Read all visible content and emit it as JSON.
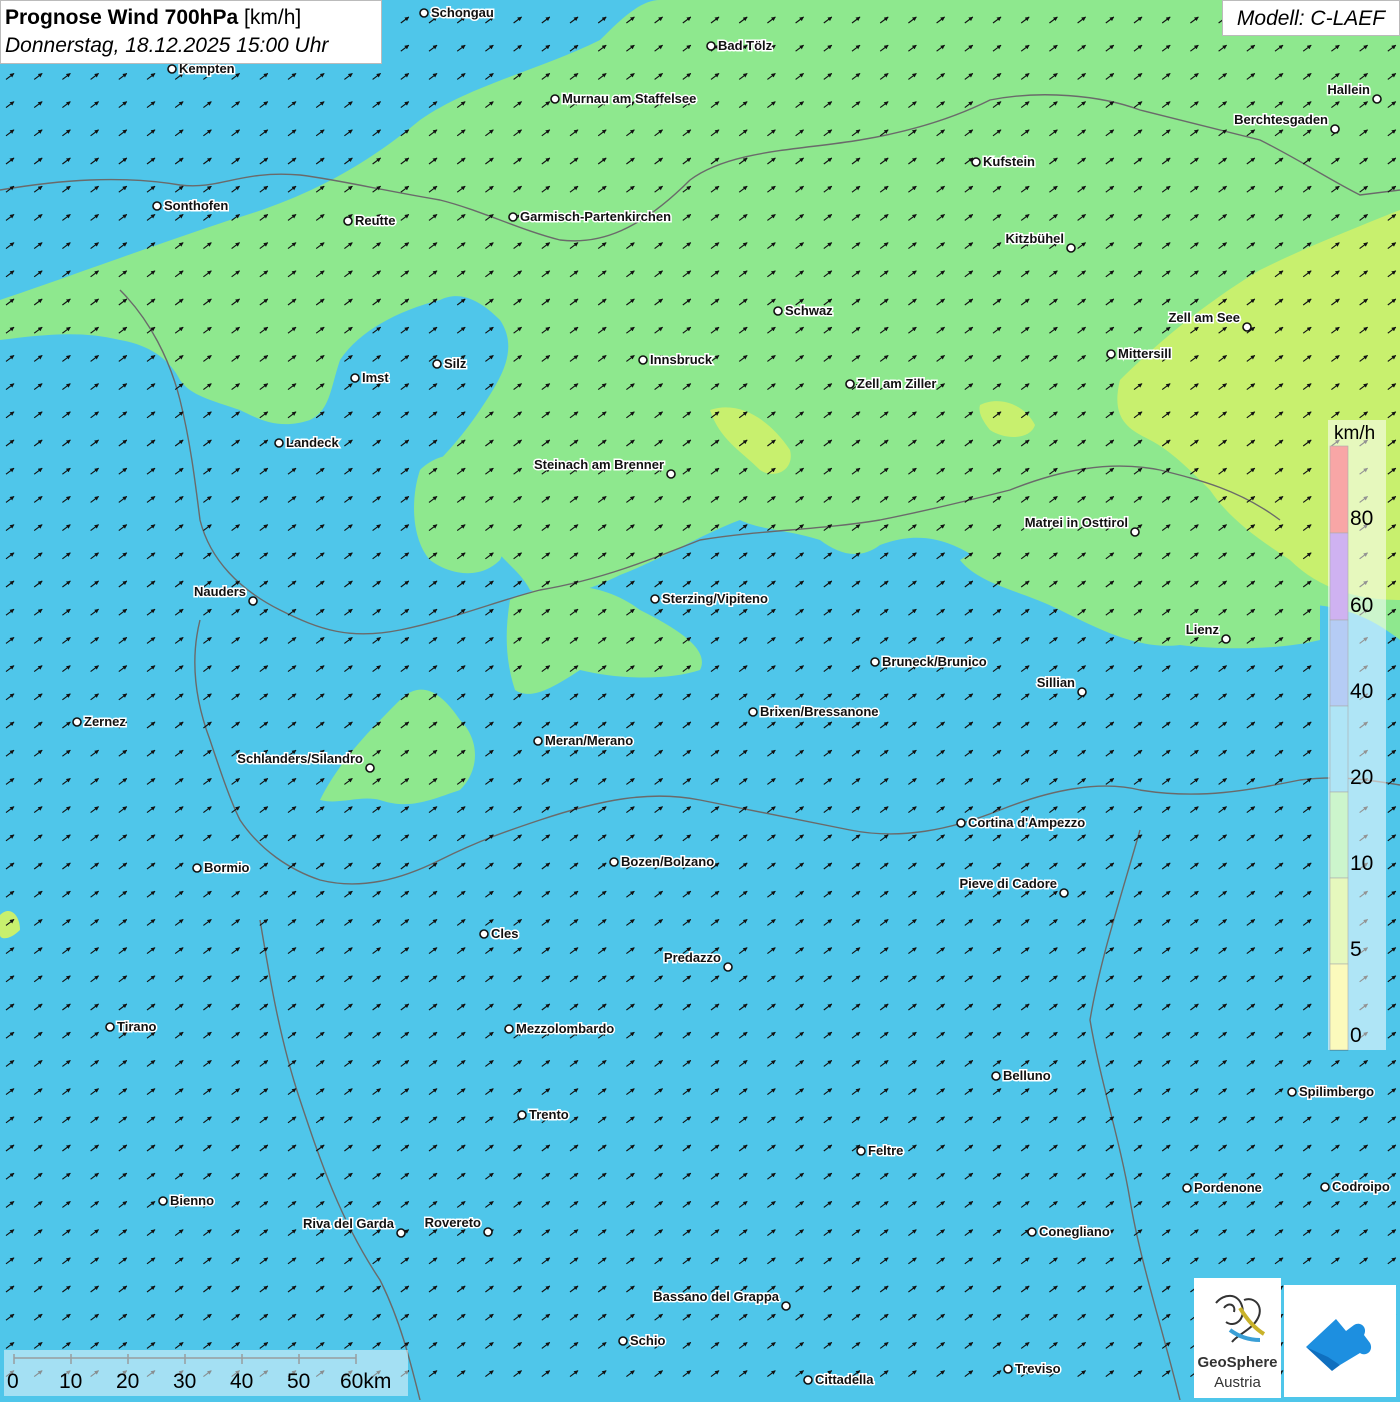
{
  "header": {
    "title_bold": "Prognose Wind 700hPa",
    "title_unit": "[km/h]",
    "datetime": "Donnerstag, 18.12.2025 15:00 Uhr",
    "model": "Modell: C-LAEF"
  },
  "colors": {
    "wind_0_5": "#f5f36a",
    "wind_5_10": "#c8f06e",
    "wind_10_20": "#8ee88e",
    "wind_20_40": "#4fc6ea",
    "wind_40_60": "#5b8ee8",
    "wind_60_80": "#9456e0",
    "wind_80_plus": "#f03a3a",
    "arrow": "#111111",
    "border_lines": "#6a6a6a"
  },
  "legend": {
    "unit": "km/h",
    "labels": [
      "80",
      "60",
      "40",
      "20",
      "10",
      "5",
      "0"
    ]
  },
  "scale": {
    "ticks": [
      "0",
      "10",
      "20",
      "30",
      "40",
      "50",
      "60km"
    ]
  },
  "cities": [
    {
      "name": "Schongau",
      "label_side": "right"
    },
    {
      "name": "Kempten",
      "label_side": "right"
    },
    {
      "name": "Bad Tölz",
      "label_side": "right"
    },
    {
      "name": "Murnau am Staffelsee",
      "label_side": "right"
    },
    {
      "name": "Hallein",
      "label_side": "left"
    },
    {
      "name": "Berchtesgaden",
      "label_side": "left"
    },
    {
      "name": "Kufstein",
      "label_side": "right"
    },
    {
      "name": "Sonthofen",
      "label_side": "right"
    },
    {
      "name": "Reutte",
      "label_side": "right"
    },
    {
      "name": "Garmisch-Partenkirchen",
      "label_side": "right"
    },
    {
      "name": "Kitzbühel",
      "label_side": "left"
    },
    {
      "name": "Schwaz",
      "label_side": "right"
    },
    {
      "name": "Zell am See",
      "label_side": "left"
    },
    {
      "name": "Mittersill",
      "label_side": "right"
    },
    {
      "name": "Innsbruck",
      "label_side": "right"
    },
    {
      "name": "Zell am Ziller",
      "label_side": "right"
    },
    {
      "name": "Silz",
      "label_side": "right"
    },
    {
      "name": "Imst",
      "label_side": "right"
    },
    {
      "name": "Landeck",
      "label_side": "right"
    },
    {
      "name": "Steinach am Brenner",
      "label_side": "left"
    },
    {
      "name": "Matrei in Osttirol",
      "label_side": "left"
    },
    {
      "name": "Nauders",
      "label_side": "left"
    },
    {
      "name": "Sterzing/Vipiteno",
      "label_side": "right"
    },
    {
      "name": "Lienz",
      "label_side": "left"
    },
    {
      "name": "Bruneck/Brunico",
      "label_side": "right"
    },
    {
      "name": "Sillian",
      "label_side": "left"
    },
    {
      "name": "Zernez",
      "label_side": "right"
    },
    {
      "name": "Brixen/Bressanone",
      "label_side": "right"
    },
    {
      "name": "Meran/Merano",
      "label_side": "right"
    },
    {
      "name": "Schlanders/Silandro",
      "label_side": "left"
    },
    {
      "name": "Cortina d'Ampezzo",
      "label_side": "right"
    },
    {
      "name": "Bozen/Bolzano",
      "label_side": "right"
    },
    {
      "name": "Bormio",
      "label_side": "right"
    },
    {
      "name": "Pieve di Cadore",
      "label_side": "left"
    },
    {
      "name": "Cles",
      "label_side": "right"
    },
    {
      "name": "Predazzo",
      "label_side": "left"
    },
    {
      "name": "Tirano",
      "label_side": "right"
    },
    {
      "name": "Mezzolombardo",
      "label_side": "right"
    },
    {
      "name": "Belluno",
      "label_side": "right"
    },
    {
      "name": "Spilimbergo",
      "label_side": "right"
    },
    {
      "name": "Trento",
      "label_side": "right"
    },
    {
      "name": "Feltre",
      "label_side": "right"
    },
    {
      "name": "Pordenone",
      "label_side": "right"
    },
    {
      "name": "Codroipo",
      "label_side": "right"
    },
    {
      "name": "Bienno",
      "label_side": "right"
    },
    {
      "name": "Riva del Garda",
      "label_side": "left"
    },
    {
      "name": "Rovereto",
      "label_side": "left"
    },
    {
      "name": "Conegliano",
      "label_side": "right"
    },
    {
      "name": "Bassano del Grappa",
      "label_side": "left"
    },
    {
      "name": "Schio",
      "label_side": "right"
    },
    {
      "name": "Treviso",
      "label_side": "right"
    },
    {
      "name": "Cittadella",
      "label_side": "right"
    }
  ],
  "logos": {
    "geosphere_name": "GeoSphere",
    "geosphere_country": "Austria",
    "app_logo_icon": "cloud-arrow-icon",
    "geosphere_icon": "geosphere-swirl-icon"
  }
}
